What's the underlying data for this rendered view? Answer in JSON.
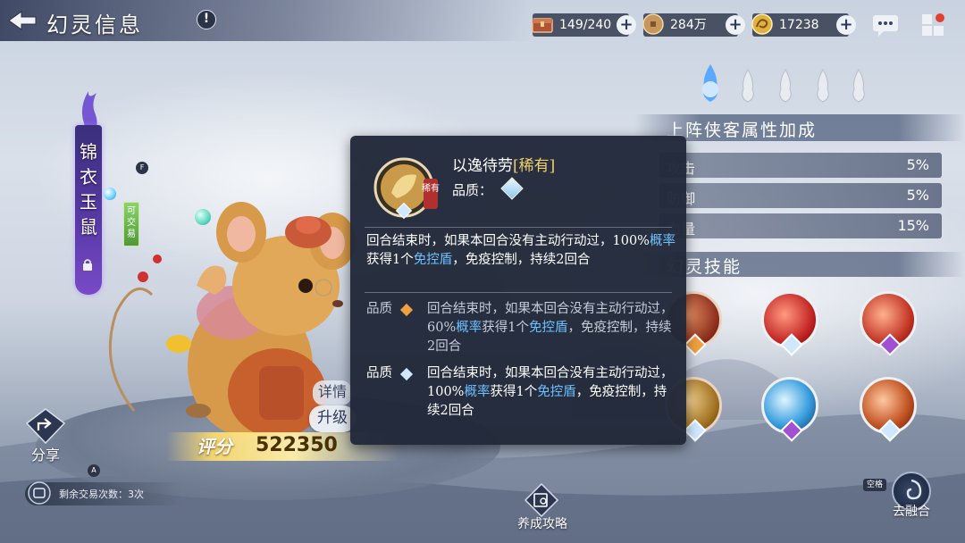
{
  "header": {
    "title": "幻灵信息",
    "info_label": "!"
  },
  "resources": [
    {
      "name": "stamina",
      "value": "149/240",
      "icon": "chest-icon"
    },
    {
      "name": "coins",
      "value": "284万",
      "icon": "coin-icon"
    },
    {
      "name": "gold",
      "value": "17238",
      "icon": "dragon-coin-icon"
    }
  ],
  "spirit": {
    "name": "锦衣玉鼠",
    "tradeable_tag": "可交易",
    "score_label": "评分",
    "score_value": "522350",
    "detail_label": "详情",
    "upgrade_label": "升级"
  },
  "keys": {
    "f": "F",
    "a": "A",
    "space": "空格"
  },
  "actions": {
    "share_label": "分享",
    "trades_remaining": "剩余交易次数：3次",
    "nurture_label": "养成攻略",
    "fusion_label": "去融合"
  },
  "attributes": {
    "title": "上阵侠客属性加成",
    "rows": [
      {
        "name": "攻击",
        "value": "5%"
      },
      {
        "name": "防御",
        "value": "5%"
      },
      {
        "name": "血量",
        "value": "15%"
      }
    ]
  },
  "skills": {
    "title": "幻灵技能"
  },
  "tooltip": {
    "name": "以逸待劳",
    "rarity": "[稀有]",
    "quality_label": "品质：",
    "badge_text": "稀有",
    "main_desc_1": "回合结束时，如果本回合没有主动行动过，100%",
    "main_desc_hl1": "概率",
    "main_desc_2": "获得1个",
    "main_desc_hl2": "免控盾",
    "main_desc_3": "，免疫控制，持续2回合",
    "alt": [
      {
        "quality": "品质",
        "d1": "回合结束时，如果本回合没有主动行动过，60%",
        "h1": "概率",
        "d2": "获得1个",
        "h2": "免控盾",
        "d3": "，免疫控制，持续2回合",
        "gem_color": "#f0a040"
      },
      {
        "quality": "品质",
        "d1": "回合结束时，如果本回合没有主动行动过，100%",
        "h1": "概率",
        "d2": "获得1个",
        "h2": "免控盾",
        "d3": "，免疫控制，持续2回合",
        "gem_color": "#cfe8ff"
      }
    ]
  },
  "colors": {
    "highlight": "#6ec0ff",
    "rarity": "#f0d06a",
    "tooltip_bg": "#202838"
  }
}
